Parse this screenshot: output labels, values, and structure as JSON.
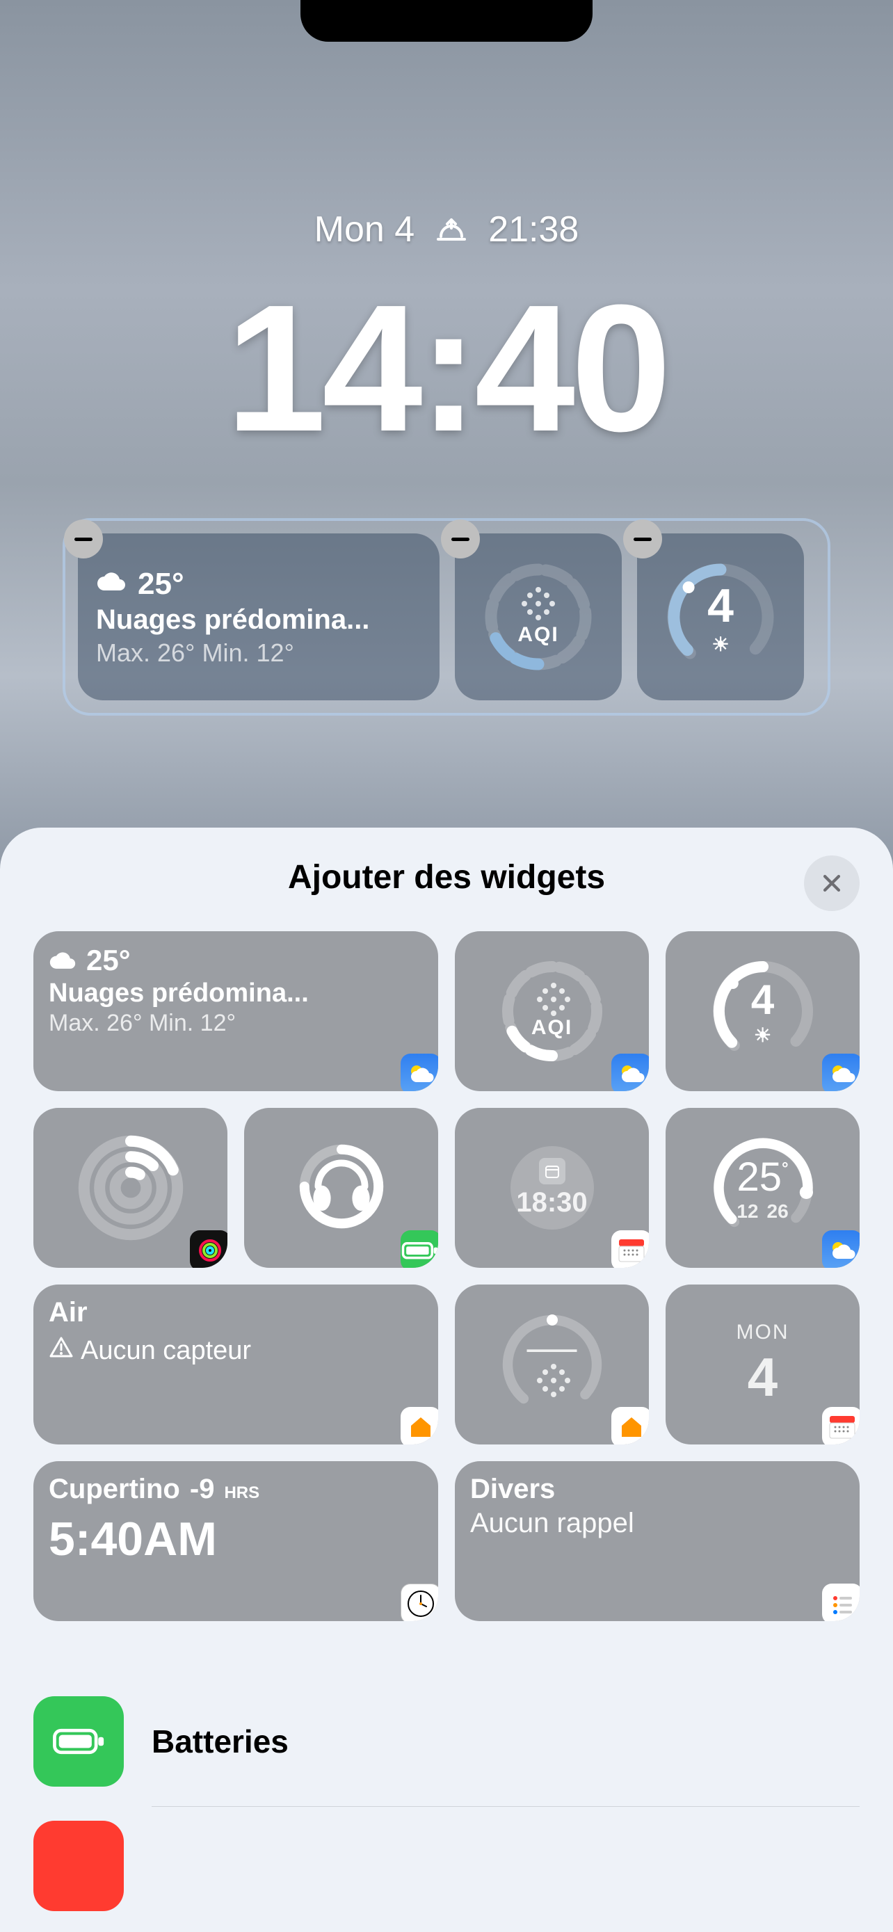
{
  "lockscreen": {
    "date_label": "Mon 4",
    "sunset_time": "21:38",
    "clock": "14:40"
  },
  "selected_widgets": {
    "weather": {
      "temp": "25°",
      "condition": "Nuages prédomina...",
      "minmax": "Max. 26° Min. 12°"
    },
    "aqi_label": "AQI",
    "uv_value": "4"
  },
  "sheet": {
    "title": "Ajouter des widgets"
  },
  "suggestions": {
    "weather": {
      "temp": "25°",
      "condition": "Nuages prédomina...",
      "minmax": "Max. 26° Min. 12°"
    },
    "aqi_label": "AQI",
    "uv_value": "4",
    "next_event_time": "18:30",
    "temp_widget": {
      "main": "25",
      "low": "12",
      "high": "26"
    },
    "air": {
      "title": "Air",
      "subtitle": "Aucun capteur"
    },
    "home_climate_value": "——",
    "calendar": {
      "dow": "MON",
      "day": "4"
    },
    "world_clock": {
      "city": "Cupertino",
      "offset": "-9",
      "hrs_label": "HRS",
      "time": "5:40AM"
    },
    "reminders": {
      "title": "Divers",
      "subtitle": "Aucun rappel"
    }
  },
  "app_list": {
    "batteries": "Batteries"
  }
}
